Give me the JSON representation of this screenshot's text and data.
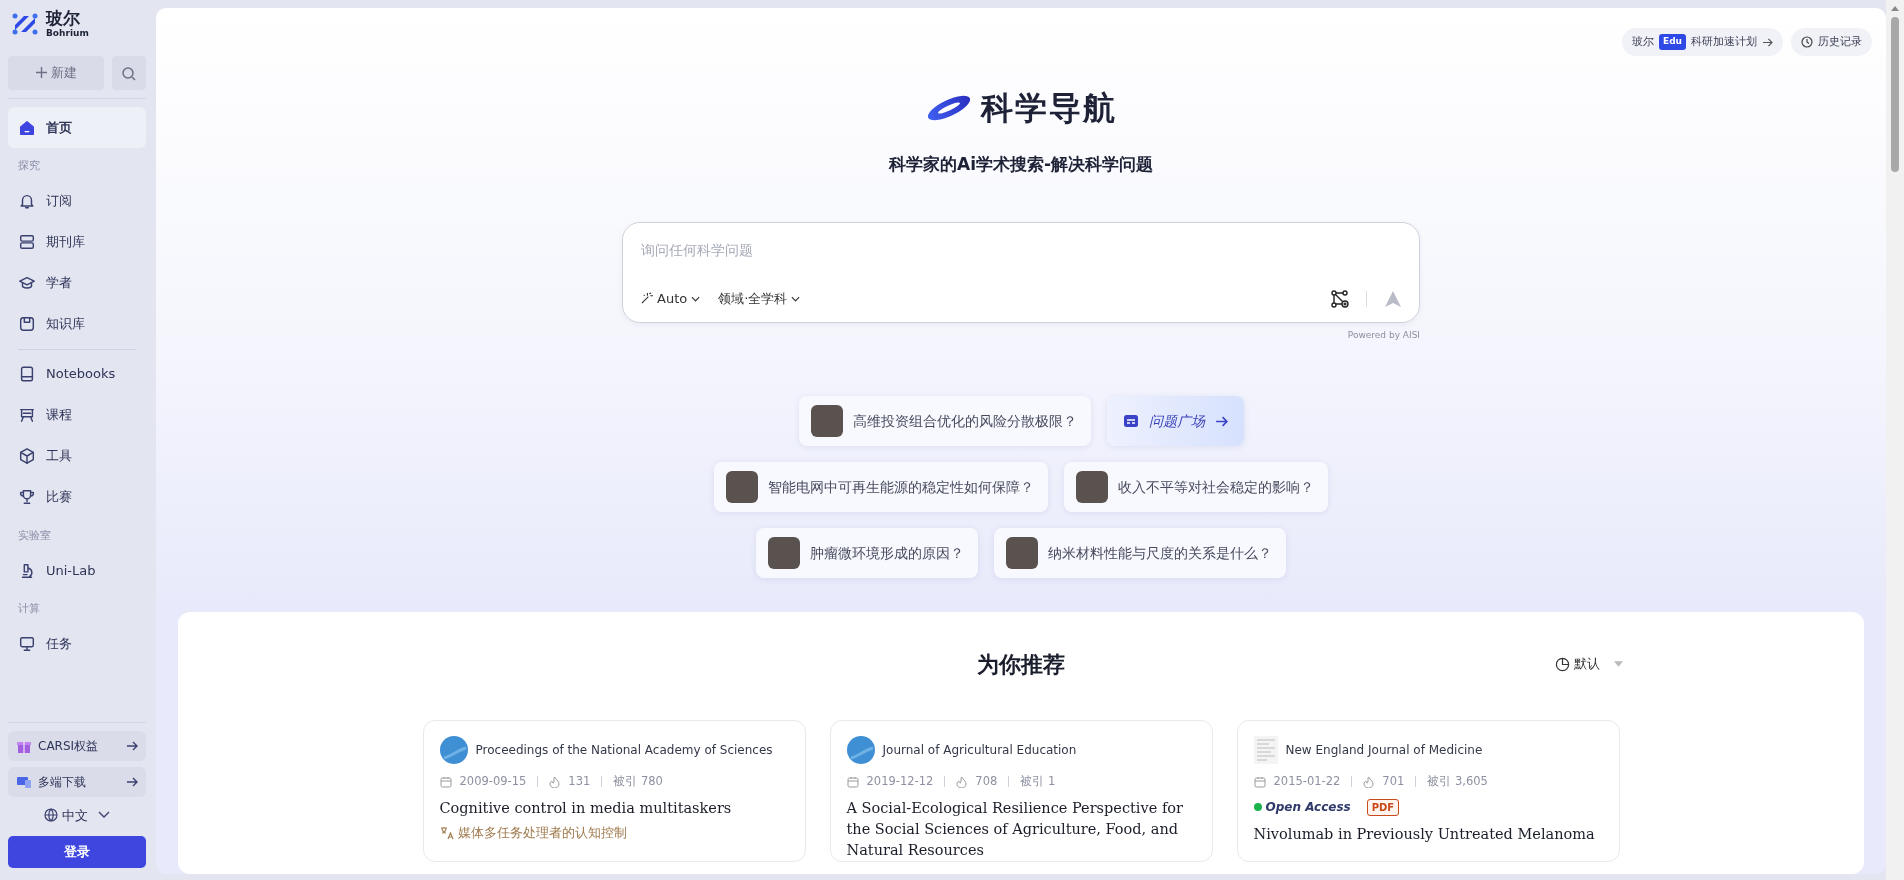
{
  "brand": {
    "name": "玻尔",
    "sub": "Bohrium"
  },
  "new_button": "新建",
  "nav": [
    {
      "kind": "item",
      "label": "首页",
      "selected": true
    },
    {
      "kind": "section",
      "label": "探究"
    },
    {
      "kind": "item",
      "label": "订阅",
      "selected": false
    },
    {
      "kind": "item",
      "label": "期刊库",
      "selected": false
    },
    {
      "kind": "item",
      "label": "学者",
      "selected": false
    },
    {
      "kind": "item",
      "label": "知识库",
      "selected": false
    },
    {
      "kind": "divider"
    },
    {
      "kind": "item",
      "label": "Notebooks",
      "selected": false
    },
    {
      "kind": "item",
      "label": "课程",
      "selected": false
    },
    {
      "kind": "item",
      "label": "工具",
      "selected": false
    },
    {
      "kind": "item",
      "label": "比赛",
      "selected": false
    },
    {
      "kind": "section",
      "label": "实验室"
    },
    {
      "kind": "item",
      "label": "Uni-Lab",
      "selected": false
    },
    {
      "kind": "section",
      "label": "计算"
    },
    {
      "kind": "item",
      "label": "任务",
      "selected": false
    }
  ],
  "promos": [
    {
      "label": "CARSI权益"
    },
    {
      "label": "多端下载"
    }
  ],
  "language": "中文",
  "login_button": "登录",
  "top_links": {
    "edu": {
      "brand": "玻尔",
      "tag": "Edu",
      "text": "科研加速计划"
    },
    "history": "历史记录"
  },
  "hero": {
    "title": "科学导航",
    "subtitle": "科学家的Ai学术搜索-解决科学问题"
  },
  "search": {
    "placeholder": "询问任何科学问题",
    "mode": "Auto",
    "domain": "领域·全学科",
    "powered_by": "Powered by AISI"
  },
  "suggestion_rows": [
    {
      "items": [
        {
          "kind": "question",
          "text": "高维投资组合优化的风险分散极限？"
        },
        {
          "kind": "plaza",
          "text": "问题广场"
        }
      ]
    },
    {
      "items": [
        {
          "kind": "question",
          "text": "智能电网中可再生能源的稳定性如何保障？"
        },
        {
          "kind": "question",
          "text": "收入不平等对社会稳定的影响？"
        }
      ]
    },
    {
      "items": [
        {
          "kind": "question",
          "text": "肿瘤微环境形成的原因？"
        },
        {
          "kind": "question",
          "text": "纳米材料性能与尺度的关系是什么？"
        }
      ]
    }
  ],
  "recommend": {
    "title": "为你推荐",
    "sort": "默认",
    "cards": [
      {
        "kind": "circle",
        "journal": "Proceedings of the National Academy of Sciences",
        "date": "2009-09-15",
        "views": "131",
        "cited": "被引 780",
        "title": "Cognitive control in media multitaskers",
        "translation": "媒体多任务处理者的认知控制"
      },
      {
        "kind": "circle",
        "journal": "Journal of Agricultural Education",
        "date": "2019-12-12",
        "views": "708",
        "cited": "被引 1",
        "title": "A Social-Ecological Resilience Perspective for the Social Sciences of Agriculture, Food, and Natural Resources"
      },
      {
        "kind": "document",
        "journal": "New England Journal of Medicine",
        "date": "2015-01-22",
        "views": "701",
        "cited": "被引 3,605",
        "access": "Open Access",
        "pdf": "PDF",
        "title": "Nivolumab in Previously Untreated Melanoma"
      }
    ]
  }
}
